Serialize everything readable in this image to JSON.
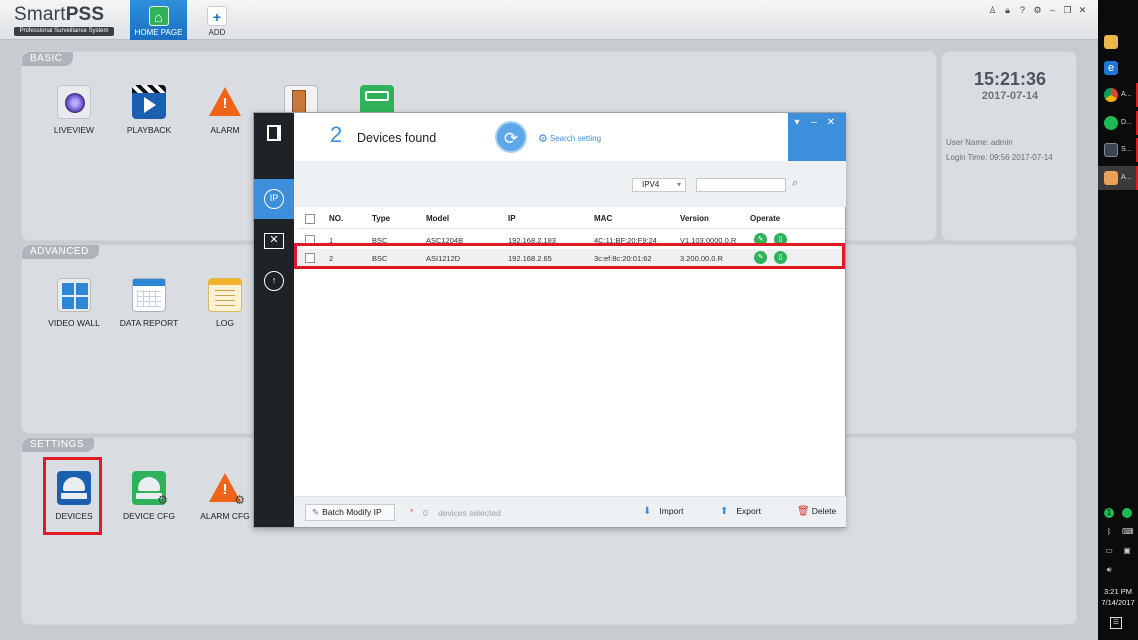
{
  "app": {
    "logo_title_a": "Smart",
    "logo_title_b": "PSS",
    "logo_subtitle": "Professional Surveillance System",
    "tabs": [
      {
        "label": "HOME PAGE",
        "icon": "home-icon"
      },
      {
        "label": "ADD",
        "icon": "plus-icon"
      }
    ],
    "window_controls": [
      "user-icon",
      "lock-icon",
      "help-icon",
      "settings-icon",
      "minimize-icon",
      "restore-icon",
      "close-icon"
    ]
  },
  "sections": {
    "basic": {
      "label": "BASIC",
      "items": [
        {
          "label": "LIVEVIEW",
          "icon": "camera-lens-icon"
        },
        {
          "label": "PLAYBACK",
          "icon": "clapperboard-icon"
        },
        {
          "label": "ALARM",
          "icon": "warning-icon"
        },
        {
          "label": "",
          "icon": "door-icon"
        },
        {
          "label": "",
          "icon": "network-icon"
        }
      ]
    },
    "advanced": {
      "label": "ADVANCED",
      "items": [
        {
          "label": "VIDEO WALL",
          "icon": "video-wall-icon"
        },
        {
          "label": "DATA REPORT",
          "icon": "report-icon"
        },
        {
          "label": "LOG",
          "icon": "log-icon"
        }
      ]
    },
    "settings": {
      "label": "SETTINGS",
      "items": [
        {
          "label": "DEVICES",
          "icon": "devices-icon"
        },
        {
          "label": "DEVICE CFG",
          "icon": "device-cfg-icon"
        },
        {
          "label": "ALARM CFG",
          "icon": "alarm-cfg-icon"
        }
      ]
    }
  },
  "clock": {
    "time": "15:21:36",
    "date": "2017-07-14",
    "user_line": "User Name:  admin",
    "login_line": "Login Time:  09:56 2017-07-14"
  },
  "dialog": {
    "found_count": "2",
    "found_text": "Devices found",
    "search_setting": "Search setting",
    "ip_version": "IPV4",
    "search_placeholder": "",
    "columns": [
      "NO.",
      "Type",
      "Model",
      "IP",
      "MAC",
      "Version",
      "Operate"
    ],
    "rows": [
      {
        "no": "1",
        "type": "BSC",
        "model": "ASC1204B",
        "ip": "192.168.2.183",
        "mac": "4C:11:BF:20:F9:24",
        "version": "V1.103.0000.0.R"
      },
      {
        "no": "2",
        "type": "BSC",
        "model": "ASI1212D",
        "ip": "192.168.2.65",
        "mac": "3c:ef:8c:20:01:62",
        "version": "3.200.00.0.R"
      }
    ],
    "batch_modify": "Batch Modify IP",
    "selected_count": "0",
    "selected_text": "devices selected",
    "import_label": "Import",
    "export_label": "Export",
    "delete_label": "Delete"
  },
  "taskbar": {
    "apps": [
      {
        "label": "",
        "icon": "folder-icon"
      },
      {
        "label": "",
        "icon": "ie-icon"
      },
      {
        "label": "A...",
        "icon": "chrome-icon"
      },
      {
        "label": "D...",
        "icon": "spotify-icon"
      },
      {
        "label": "S...",
        "icon": "smartpss-icon"
      },
      {
        "label": "A...",
        "icon": "app-icon"
      }
    ],
    "time": "3:21 PM",
    "date": "7/14/2017"
  }
}
